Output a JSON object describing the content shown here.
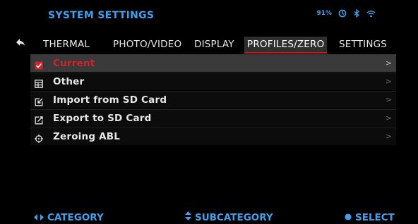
{
  "header": {
    "title": "SYSTEM SETTINGS",
    "status": {
      "battery": "91%",
      "icons": [
        "timer-icon",
        "bluetooth-icon",
        "wifi-icon"
      ]
    }
  },
  "tabs": [
    {
      "label": "THERMAL",
      "active": false
    },
    {
      "label": "PHOTO/VIDEO",
      "active": false
    },
    {
      "label": "DISPLAY",
      "active": false
    },
    {
      "label": "PROFILES/ZERO",
      "active": true
    },
    {
      "label": "SETTINGS",
      "active": false
    }
  ],
  "menu": {
    "items": [
      {
        "label": "Current",
        "icon": "checkbox-icon",
        "selected": true
      },
      {
        "label": "Other",
        "icon": "profile-list-icon",
        "selected": false
      },
      {
        "label": "Import from SD Card",
        "icon": "import-icon",
        "selected": false
      },
      {
        "label": "Export to SD Card",
        "icon": "export-icon",
        "selected": false
      },
      {
        "label": "Zeroing ABL",
        "icon": "zeroing-icon",
        "selected": false
      }
    ],
    "chevron": ">"
  },
  "footer": {
    "category": "CATEGORY",
    "subcategory": "SUBCATEGORY",
    "select": "SELECT"
  },
  "colors": {
    "accent": "#3fa0ee",
    "selected_text": "#d1232b",
    "tab_underline": "#c01c1c"
  }
}
